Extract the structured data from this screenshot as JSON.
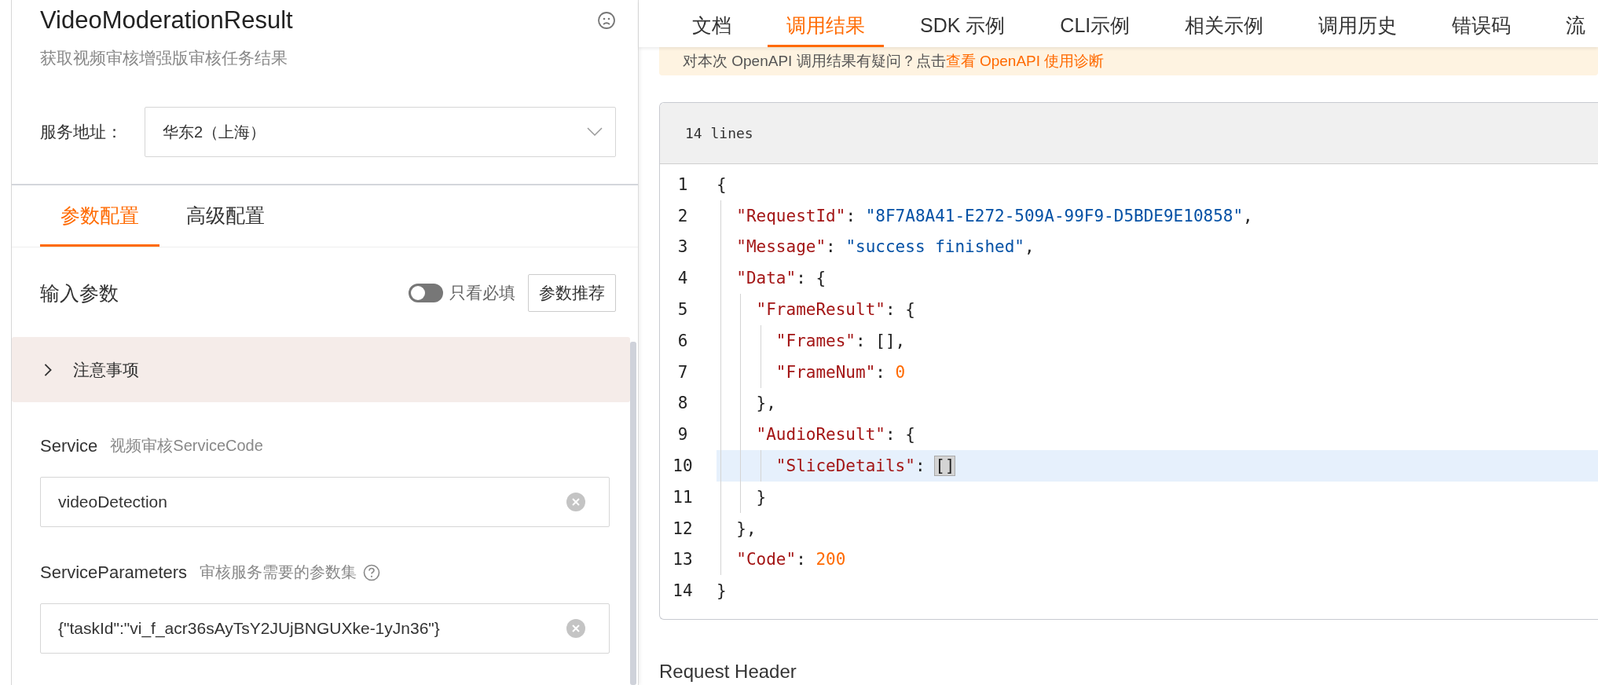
{
  "panel": {
    "title": "VideoModerationResult",
    "subtitle": "获取视频审核增强版审核任务结果",
    "endpoint": {
      "label": "服务地址：",
      "value": "华东2（上海）"
    },
    "tabs": [
      {
        "label": "参数配置",
        "selected": true
      },
      {
        "label": "高级配置",
        "selected": false
      }
    ],
    "section": {
      "title": "输入参数",
      "required_only": {
        "label": "只看必填",
        "on": false
      },
      "button": "参数推荐"
    },
    "notice": {
      "title": "注意事项",
      "expanded": false
    },
    "params": [
      {
        "name": "Service",
        "description": "视频审核ServiceCode",
        "help": false,
        "value": "videoDetection"
      },
      {
        "name": "ServiceParameters",
        "description": "审核服务需要的参数集",
        "help": true,
        "value": "{\"taskId\":\"vi_f_acr36sAyTsY2JUjBNGUXke-1yJn36\"}"
      }
    ]
  },
  "result_tabs": [
    {
      "label": "文档",
      "selected": false
    },
    {
      "label": "调用结果",
      "selected": true
    },
    {
      "label": "SDK 示例",
      "selected": false
    },
    {
      "label": "CLI示例",
      "selected": false
    },
    {
      "label": "相关示例",
      "selected": false
    },
    {
      "label": "调用历史",
      "selected": false
    },
    {
      "label": "错误码",
      "selected": false
    },
    {
      "label": "流",
      "selected": false
    }
  ],
  "banner": {
    "text": "对本次 OpenAPI 调用结果有疑问？点击",
    "link": "查看 OpenAPI 使用诊断"
  },
  "code": {
    "header": "14 lines",
    "lines": [
      {
        "number": "1",
        "highlighted": false,
        "tokens": [
          {
            "kind": "punct",
            "text": "{"
          }
        ]
      },
      {
        "number": "2",
        "highlighted": false,
        "tokens": [
          {
            "kind": "key",
            "text": "  \"RequestId\""
          },
          {
            "kind": "punct",
            "text": ": "
          },
          {
            "kind": "string",
            "text": "\"8F7A8A41-E272-509A-99F9-D5BDE9E10858\""
          },
          {
            "kind": "punct",
            "text": ","
          }
        ]
      },
      {
        "number": "3",
        "highlighted": false,
        "tokens": [
          {
            "kind": "key",
            "text": "  \"Message\""
          },
          {
            "kind": "punct",
            "text": ": "
          },
          {
            "kind": "string",
            "text": "\"success finished\""
          },
          {
            "kind": "punct",
            "text": ","
          }
        ]
      },
      {
        "number": "4",
        "highlighted": false,
        "tokens": [
          {
            "kind": "key",
            "text": "  \"Data\""
          },
          {
            "kind": "punct",
            "text": ": {"
          }
        ]
      },
      {
        "number": "5",
        "highlighted": false,
        "tokens": [
          {
            "kind": "key",
            "text": "    \"FrameResult\""
          },
          {
            "kind": "punct",
            "text": ": {"
          }
        ]
      },
      {
        "number": "6",
        "highlighted": false,
        "tokens": [
          {
            "kind": "key",
            "text": "      \"Frames\""
          },
          {
            "kind": "punct",
            "text": ": [],"
          }
        ]
      },
      {
        "number": "7",
        "highlighted": false,
        "tokens": [
          {
            "kind": "key",
            "text": "      \"FrameNum\""
          },
          {
            "kind": "punct",
            "text": ": "
          },
          {
            "kind": "number",
            "text": "0"
          }
        ]
      },
      {
        "number": "8",
        "highlighted": false,
        "tokens": [
          {
            "kind": "punct",
            "text": "    },"
          }
        ]
      },
      {
        "number": "9",
        "highlighted": false,
        "tokens": [
          {
            "kind": "key",
            "text": "    \"AudioResult\""
          },
          {
            "kind": "punct",
            "text": ": {"
          }
        ]
      },
      {
        "number": "10",
        "highlighted": true,
        "tokens": [
          {
            "kind": "key",
            "text": "      \"SliceDetails\""
          },
          {
            "kind": "punct",
            "text": ": "
          },
          {
            "kind": "match",
            "text": "[]"
          }
        ]
      },
      {
        "number": "11",
        "highlighted": false,
        "tokens": [
          {
            "kind": "punct",
            "text": "    }"
          }
        ]
      },
      {
        "number": "12",
        "highlighted": false,
        "tokens": [
          {
            "kind": "punct",
            "text": "  },"
          }
        ]
      },
      {
        "number": "13",
        "highlighted": false,
        "tokens": [
          {
            "kind": "key",
            "text": "  \"Code\""
          },
          {
            "kind": "punct",
            "text": ": "
          },
          {
            "kind": "number",
            "text": "200"
          }
        ]
      },
      {
        "number": "14",
        "highlighted": false,
        "tokens": [
          {
            "kind": "punct",
            "text": "}"
          }
        ]
      }
    ]
  },
  "next_section": "Request Header"
}
